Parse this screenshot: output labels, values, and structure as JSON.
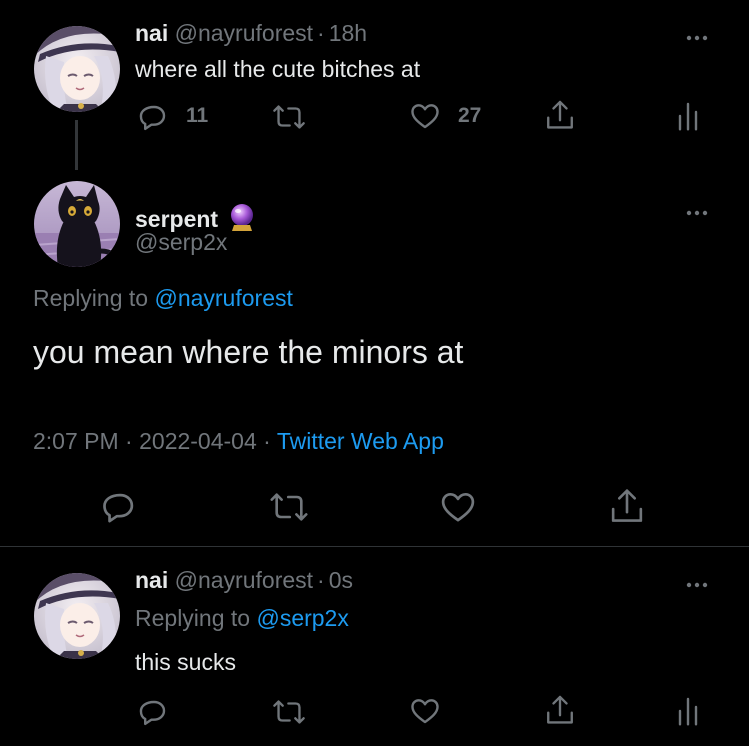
{
  "tweet1": {
    "name": "nai",
    "handle": "@nayruforest",
    "sep": "·",
    "time": "18h",
    "text": "where all the cute bitches at",
    "reply_count": "11",
    "like_count": "27"
  },
  "main": {
    "name": "serpent",
    "handle": "@serp2x",
    "replying_prefix": "Replying to",
    "replying_to": "@nayruforest",
    "text": "you mean where the minors at",
    "time": "2:07 PM",
    "sep1": "·",
    "date": "2022-04-04",
    "sep2": "·",
    "source": "Twitter Web App"
  },
  "tweet3": {
    "name": "nai",
    "handle": "@nayruforest",
    "sep": "·",
    "time": "0s",
    "replying_prefix": "Replying to",
    "replying_to": "@serp2x",
    "text": "this sucks"
  },
  "colors": {
    "background": "#000000",
    "text": "#e7e9ea",
    "muted": "#71767b",
    "link": "#1d9bf0"
  },
  "icons": [
    "reply-icon",
    "retweet-icon",
    "like-icon",
    "share-icon",
    "analytics-icon",
    "more-icon",
    "crystal-ball-emoji"
  ]
}
